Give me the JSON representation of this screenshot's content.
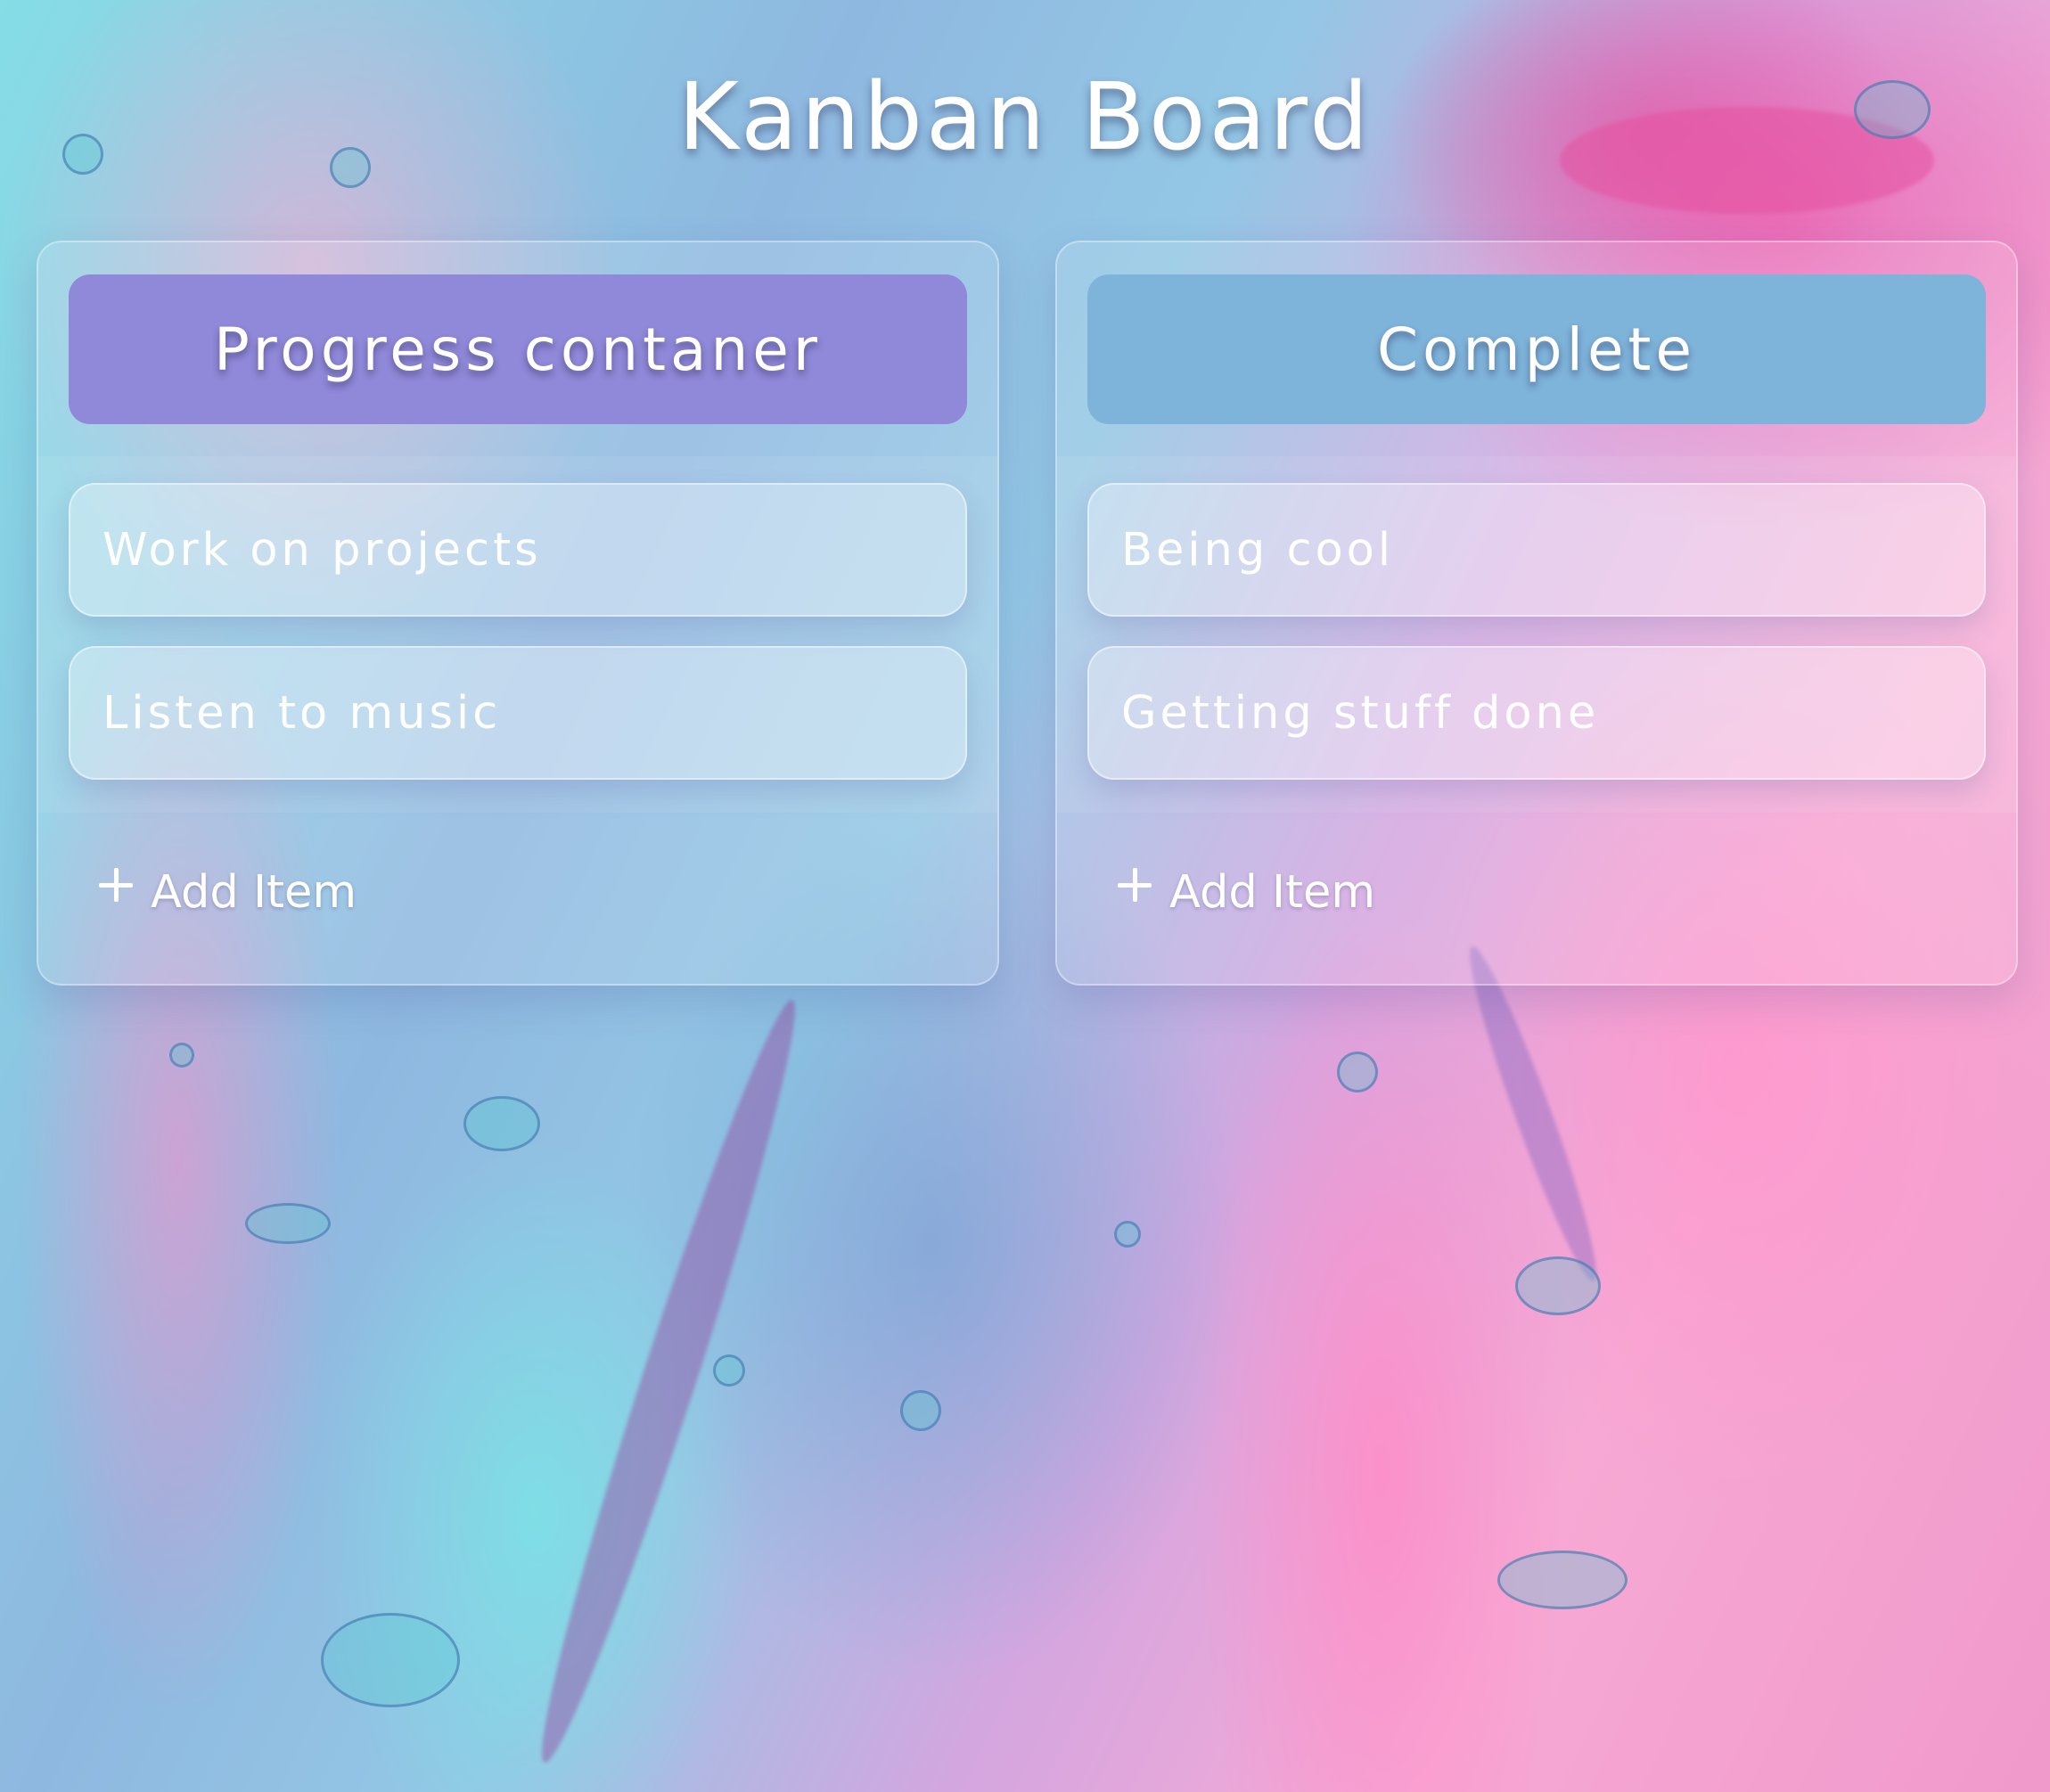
{
  "page": {
    "title": "Kanban Board"
  },
  "columns": [
    {
      "header": "Progress contaner",
      "header_color": "#9088d8",
      "items": [
        "Work on projects",
        "Listen to music"
      ],
      "add_label": "Add Item"
    },
    {
      "header": "Complete",
      "header_color": "#7eb3da",
      "items": [
        "Being cool",
        "Getting stuff done"
      ],
      "add_label": "Add Item"
    }
  ],
  "icons": {
    "add": "plus-icon"
  }
}
